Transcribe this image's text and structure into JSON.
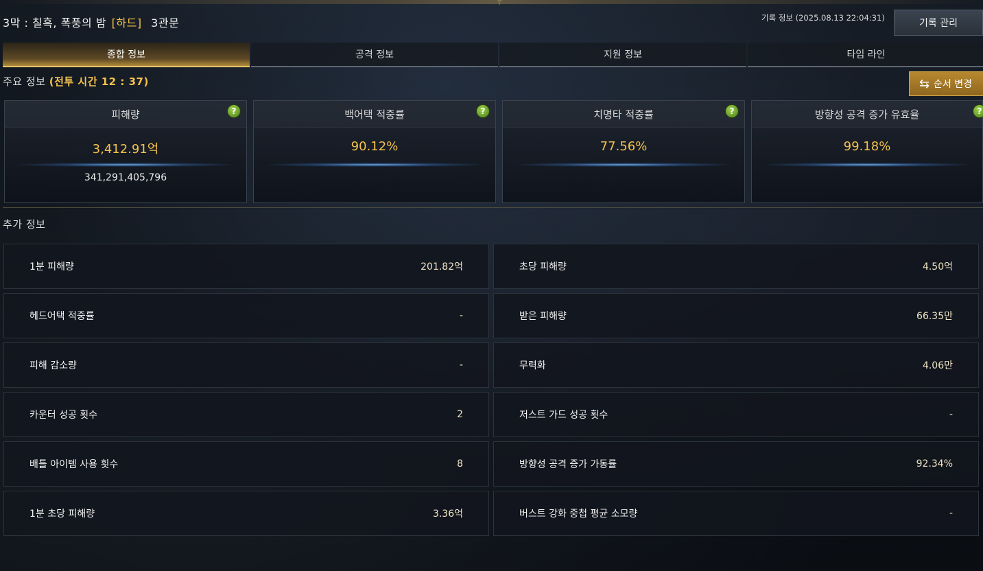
{
  "header": {
    "title_main": "3막 : 칠흑, 폭풍의 밤",
    "difficulty": "[하드]",
    "gate": "3관문",
    "record_time": "기록 정보 (2025.08.13 22:04:31)",
    "record_manage_label": "기록 관리"
  },
  "tabs": [
    {
      "label": "종합 정보",
      "active": true
    },
    {
      "label": "공격 정보",
      "active": false
    },
    {
      "label": "지원 정보",
      "active": false
    },
    {
      "label": "타임 라인",
      "active": false
    }
  ],
  "main_info": {
    "label": "주요 정보",
    "battle_time": "(전투 시간 12 : 37)",
    "reorder_label": "순서 변경",
    "reorder_icon": "swap-icon"
  },
  "stat_cards": [
    {
      "title": "피해량",
      "value": "3,412.91억",
      "subvalue": "341,291,405,796"
    },
    {
      "title": "백어택 적중률",
      "value": "90.12%"
    },
    {
      "title": "치명타 적중률",
      "value": "77.56%"
    },
    {
      "title": "방향성 공격 증가 유효율",
      "value": "99.18%"
    }
  ],
  "extra_info": {
    "label": "추가 정보",
    "rows": [
      {
        "label": "1분 피해량",
        "value": "201.82억"
      },
      {
        "label": "초당 피해량",
        "value": "4.50억"
      },
      {
        "label": "헤드어택 적중률",
        "value": "-"
      },
      {
        "label": "받은 피해량",
        "value": "66.35만"
      },
      {
        "label": "피해 감소량",
        "value": "-"
      },
      {
        "label": "무력화",
        "value": "4.06만"
      },
      {
        "label": "카운터 성공 횟수",
        "value": "2"
      },
      {
        "label": "저스트 가드 성공 횟수",
        "value": "-"
      },
      {
        "label": "배틀 아이템 사용 횟수",
        "value": "8"
      },
      {
        "label": "방향성 공격 증가 가동률",
        "value": "92.34%"
      },
      {
        "label": "1분 초당 피해량",
        "value": "3.36억"
      },
      {
        "label": "버스트 강화 중첩 평균 소모량",
        "value": "-"
      }
    ]
  },
  "help_symbol": "?",
  "colors": {
    "accent_gold": "#f4c24d",
    "help_green": "#7cbf33",
    "tab_active": "#b18a3a"
  }
}
